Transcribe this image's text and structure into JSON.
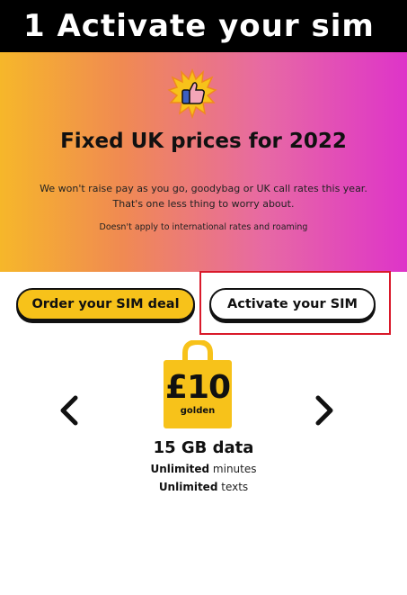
{
  "header": {
    "title": "1 Activate your sim"
  },
  "hero": {
    "icon": "flaming-thumbs-up-icon",
    "title": "Fixed UK prices for 2022",
    "body_line1": "We won't raise pay as you go, goodybag or UK call rates this year.",
    "body_line2": "That's one less thing to worry about.",
    "note": "Doesn't apply to international rates and roaming"
  },
  "buttons": {
    "order_label": "Order your SIM deal",
    "activate_label": "Activate your SIM"
  },
  "plan": {
    "price": "£10",
    "tier": "golden",
    "data": "15 GB data",
    "minutes_bold": "Unlimited",
    "minutes_rest": "minutes",
    "texts_bold": "Unlimited",
    "texts_rest": "texts"
  },
  "colors": {
    "accent_yellow": "#f7c21a",
    "highlight_red": "#d9192a",
    "gradient_left": "#f6b72a",
    "gradient_right": "#de34c9"
  }
}
